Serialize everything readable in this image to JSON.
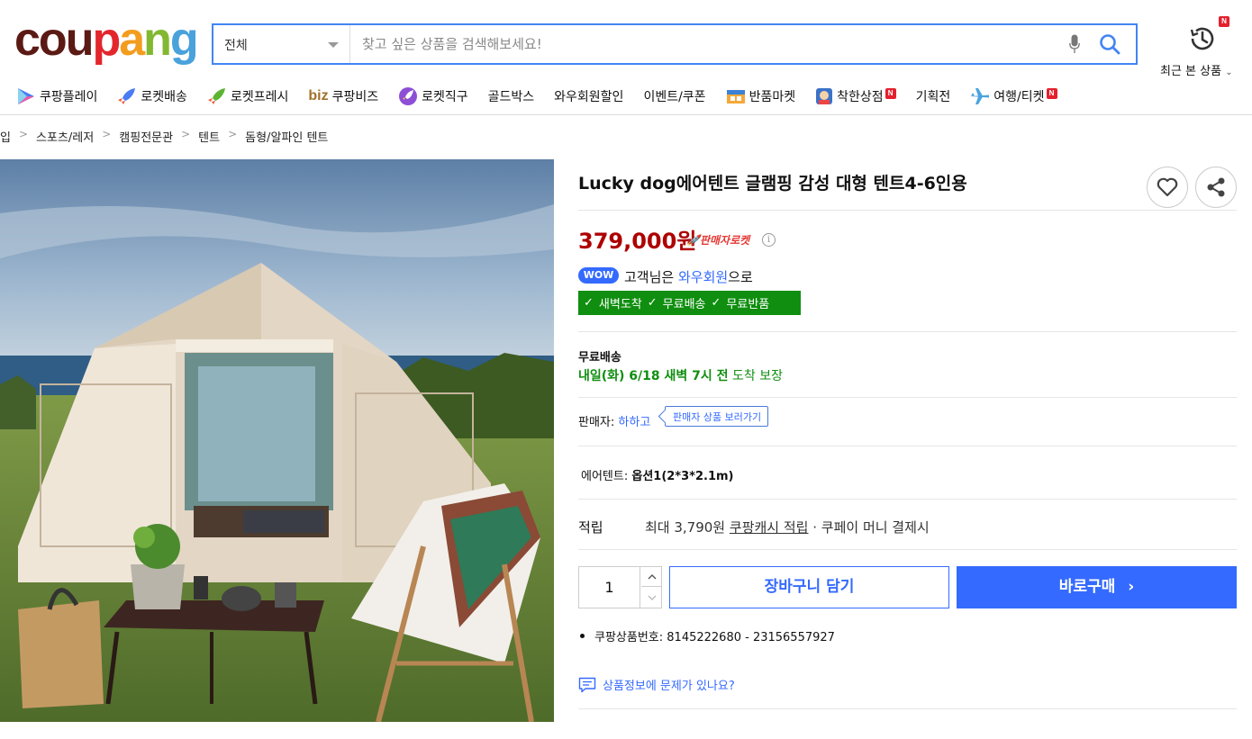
{
  "header": {
    "logo_letters": [
      "c",
      "o",
      "u",
      "p",
      "a",
      "n",
      "g"
    ],
    "logo_colors": [
      "#5c1a14",
      "#5c1a14",
      "#5c1a14",
      "#e3262d",
      "#f29d1d",
      "#82b831",
      "#49a2dc"
    ],
    "category_select": "전체",
    "search_placeholder": "찾고 싶은 상품을 검색해보세요!",
    "recent_label": "최근 본 상품",
    "new_badge": "N"
  },
  "nav": {
    "items": [
      {
        "label": "쿠팡플레이",
        "icon": "play-icon"
      },
      {
        "label": "로켓배송",
        "icon": "rocket-icon"
      },
      {
        "label": "로켓프레시",
        "icon": "rocket-fresh-icon"
      },
      {
        "label": "쿠팡비즈",
        "icon": "biz-icon",
        "prefix": "biz"
      },
      {
        "label": "로켓직구",
        "icon": "rocket-global-icon"
      },
      {
        "label": "골드박스",
        "icon": ""
      },
      {
        "label": "와우회원할인",
        "icon": ""
      },
      {
        "label": "이벤트/쿠폰",
        "icon": ""
      },
      {
        "label": "반품마켓",
        "icon": "return-market-icon"
      },
      {
        "label": "착한상점",
        "icon": "good-store-icon",
        "badge": "N"
      },
      {
        "label": "기획전",
        "icon": ""
      },
      {
        "label": "여행/티켓",
        "icon": "airplane-icon",
        "badge": "N"
      }
    ]
  },
  "breadcrumb": [
    "입",
    "스포츠/레저",
    "캠핑전문관",
    "텐트",
    "돔형/알파인 텐트"
  ],
  "product": {
    "title": "Lucky dog에어텐트 글램핑 감성 대형 텐트4-6인용",
    "price": "379,000원",
    "rocket_badge": "판매자로켓",
    "wow_badge": "WOW",
    "wow_prefix": "고객님은 ",
    "wow_link": "와우회원",
    "wow_suffix": "으로",
    "benefits": [
      "새벽도착",
      "무료배송",
      "무료반품"
    ],
    "shipping_label": "무료배송",
    "shipping_date_bold": "내일(화) 6/18 새벽 7시 전",
    "shipping_date_rest": " 도착 보장",
    "seller_label": "판매자: ",
    "seller_name": "하하고",
    "seller_link": "판매자 상품 보러가기",
    "option_label": "에어텐트: ",
    "option_value": "옵션1(2*3*2.1m)",
    "points_label": "적립",
    "points_prefix": "최대 3,790원 ",
    "points_link": "쿠팡캐시 적립",
    "points_suffix": " · 쿠페이 머니 결제시",
    "quantity": "1",
    "cart_button": "장바구니 담기",
    "buy_button": "바로구매",
    "product_number": "쿠팡상품번호: 8145222680 - 23156557927",
    "report_link": "상품정보에 문제가 있나요?"
  }
}
